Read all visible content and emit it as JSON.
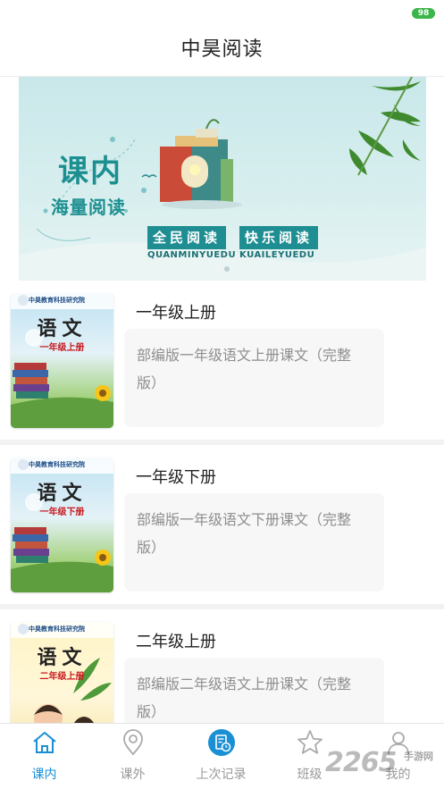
{
  "status_bar": {
    "battery": "98"
  },
  "header": {
    "title": "中昊阅读"
  },
  "banner": {
    "title_big": "课内",
    "title_sub": "海量阅读",
    "slogan_1": "全民阅读",
    "slogan_2": "快乐阅读",
    "pinyin": "QUANMINYUEDU  KUAILEYUEDU",
    "dots": 2,
    "active_dot": 0
  },
  "books": [
    {
      "title": "一年级上册",
      "description": "部编版一年级语文上册课文（完整版）",
      "cover": {
        "publisher": "中昊教育科技研究院",
        "subject": "语文",
        "grade": "一年级上册",
        "style": "blue"
      }
    },
    {
      "title": "一年级下册",
      "description": "部编版一年级语文下册课文（完整版）",
      "cover": {
        "publisher": "中昊教育科技研究院",
        "subject": "语文",
        "grade": "一年级下册",
        "style": "blue"
      }
    },
    {
      "title": "二年级上册",
      "description": "部编版二年级语文上册课文（完整版）",
      "cover": {
        "publisher": "中昊教育科技研究院",
        "subject": "语文",
        "grade": "二年级上册",
        "style": "yellow"
      }
    }
  ],
  "tabs": [
    {
      "label": "课内",
      "icon": "home-icon",
      "active": true
    },
    {
      "label": "课外",
      "icon": "location-pin-icon",
      "active": false
    },
    {
      "label": "上次记录",
      "icon": "history-record-icon",
      "active": false
    },
    {
      "label": "班级",
      "icon": "star-icon",
      "active": false
    },
    {
      "label": "我的",
      "icon": "person-icon",
      "active": false
    }
  ],
  "watermark": {
    "text": "2265",
    "sub": "手游网"
  },
  "colors": {
    "accent": "#1a8fd4",
    "tab_inactive": "#999999",
    "banner_teal": "#1f8e93",
    "battery": "#3cb54a"
  }
}
